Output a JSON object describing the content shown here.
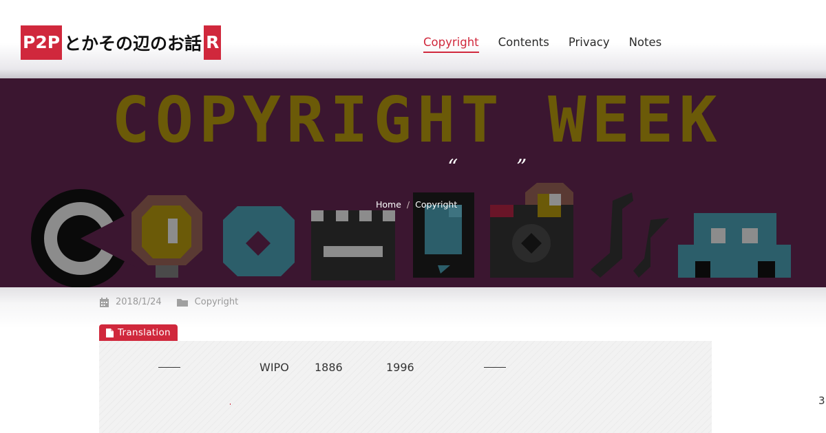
{
  "header": {
    "logo_mark_left": "P2P",
    "logo_title": "とかその辺のお話",
    "logo_mark_right": "R",
    "nav": [
      {
        "label": "Copyright",
        "active": true
      },
      {
        "label": "Contents",
        "active": false
      },
      {
        "label": "Privacy",
        "active": false
      },
      {
        "label": "Notes",
        "active": false
      }
    ]
  },
  "hero": {
    "banner_text": "COPYRIGHT WEEK",
    "quote_open": "“",
    "quote_close": "”",
    "breadcrumb": {
      "home": "Home",
      "separator": "/",
      "current": "Copyright"
    },
    "colors": {
      "background": "#3b1630",
      "banner_text": "#6b5a08"
    },
    "icons": [
      "copyright-icon",
      "lightbulb-icon",
      "cd-icon",
      "clapperboard-icon",
      "phone-icon",
      "camera-icon",
      "music-note-icon",
      "car-icon"
    ]
  },
  "meta": {
    "date": "2018/1/24",
    "category": "Copyright",
    "date_icon": "calendar-icon",
    "category_icon": "folder-icon"
  },
  "translation": {
    "tag_label": "Translation",
    "tag_icon": "document-icon",
    "line1_parts": [
      "WIPO",
      "1886",
      "1996"
    ],
    "side_number": "3"
  },
  "colors": {
    "accent": "#d0283c"
  }
}
